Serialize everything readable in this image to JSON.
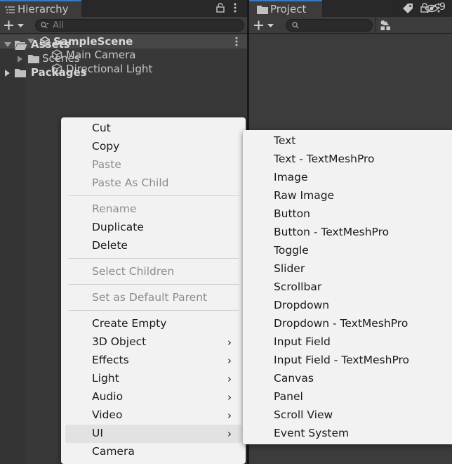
{
  "hierarchy": {
    "tab_title": "Hierarchy",
    "search_placeholder": "All",
    "scene_name": "SampleScene",
    "objects": [
      "Main Camera",
      "Directional Light"
    ]
  },
  "project": {
    "tab_title": "Project",
    "hidden_count": "9",
    "tree": {
      "assets": "Assets",
      "scenes": "Scenes",
      "packages": "Packages"
    }
  },
  "context_menu": {
    "items": [
      {
        "label": "Cut"
      },
      {
        "label": "Copy"
      },
      {
        "label": "Paste"
      },
      {
        "label": "Paste As Child"
      },
      {
        "label": "Rename"
      },
      {
        "label": "Duplicate"
      },
      {
        "label": "Delete"
      },
      {
        "label": "Select Children"
      },
      {
        "label": "Set as Default Parent"
      },
      {
        "label": "Create Empty"
      },
      {
        "label": "3D Object"
      },
      {
        "label": "Effects"
      },
      {
        "label": "Light"
      },
      {
        "label": "Audio"
      },
      {
        "label": "Video"
      },
      {
        "label": "UI"
      },
      {
        "label": "Camera"
      }
    ],
    "submenu_arrow": "›"
  },
  "ui_submenu": {
    "items": [
      "Text",
      "Text - TextMeshPro",
      "Image",
      "Raw Image",
      "Button",
      "Button - TextMeshPro",
      "Toggle",
      "Slider",
      "Scrollbar",
      "Dropdown",
      "Dropdown - TextMeshPro",
      "Input Field",
      "Input Field - TextMeshPro",
      "Canvas",
      "Panel",
      "Scroll View",
      "Event System"
    ]
  }
}
